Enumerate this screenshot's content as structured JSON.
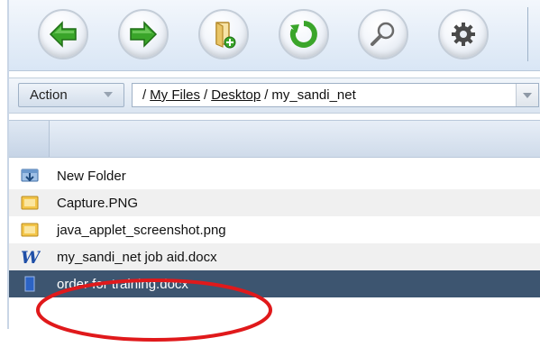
{
  "toolbar": {
    "buttons": [
      {
        "icon": "back-arrow-icon",
        "color": "#3aa52a"
      },
      {
        "icon": "forward-arrow-icon",
        "color": "#3aa52a"
      },
      {
        "icon": "new-folder-icon",
        "color": "#e0b44a"
      },
      {
        "icon": "refresh-icon",
        "color": "#3aa52a"
      },
      {
        "icon": "search-magnifier-icon",
        "color": "#555555"
      },
      {
        "icon": "gear-icon",
        "color": "#555555"
      }
    ]
  },
  "actionbar": {
    "action_label": "Action",
    "path": {
      "root_sep": "/",
      "segments": [
        "My Files",
        "Desktop",
        "my_sandi_net"
      ]
    }
  },
  "files": [
    {
      "name": "New Folder",
      "icon": "folder-download-icon"
    },
    {
      "name": "Capture.PNG",
      "icon": "image-file-icon"
    },
    {
      "name": "java_applet_screenshot.png",
      "icon": "image-file-icon"
    },
    {
      "name": "my_sandi_net job aid.docx",
      "icon": "word-document-icon"
    },
    {
      "name": "order for training.docx",
      "icon": "document-icon",
      "selected": true
    }
  ],
  "colors": {
    "selected_row": "#3d5570",
    "annotation": "#e0191b",
    "accent_green": "#3aa52a"
  }
}
